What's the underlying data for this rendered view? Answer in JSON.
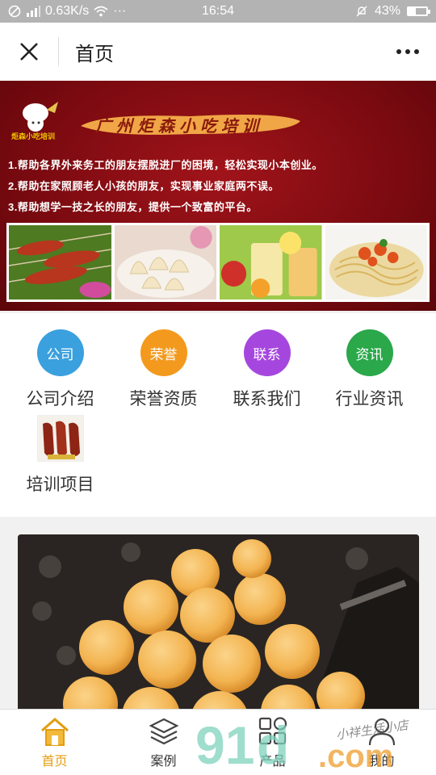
{
  "status_bar": {
    "network_speed": "0.63K/s",
    "time": "16:54",
    "battery": "43%",
    "battery_level": 0.43
  },
  "nav": {
    "title": "首页"
  },
  "banner": {
    "logo_text": "炬森小吃培训",
    "headline": "广州炬森小吃培训",
    "lines": [
      "1.帮助各界外来务工的朋友摆脱进厂的困境，轻松实现小本创业。",
      "2.帮助在家照顾老人小孩的朋友，实现事业家庭两不误。",
      "3.帮助想学一技之长的朋友，提供一个致富的平台。"
    ],
    "slide_count": 4,
    "active_slide": 3
  },
  "grid": {
    "items": [
      {
        "icon_text": "公司",
        "label": "公司介绍",
        "color": "#3aa0de"
      },
      {
        "icon_text": "荣誉",
        "label": "荣誉资质",
        "color": "#f39a1e"
      },
      {
        "icon_text": "联系",
        "label": "联系我们",
        "color": "#a547de"
      },
      {
        "icon_text": "资讯",
        "label": "行业资讯",
        "color": "#2aa84a"
      },
      {
        "label": "培训项目"
      }
    ]
  },
  "tabbar": {
    "tabs": [
      {
        "label": "首页",
        "icon": "home-icon",
        "active": true
      },
      {
        "label": "案例",
        "icon": "layers-icon",
        "active": false
      },
      {
        "label": "产品",
        "icon": "grid-icon",
        "active": false
      },
      {
        "label": "我的",
        "icon": "user-icon",
        "active": false
      }
    ],
    "accent": "#e39d12"
  },
  "watermark": {
    "text": "小祥生活小店",
    "brand": "91d.com"
  }
}
